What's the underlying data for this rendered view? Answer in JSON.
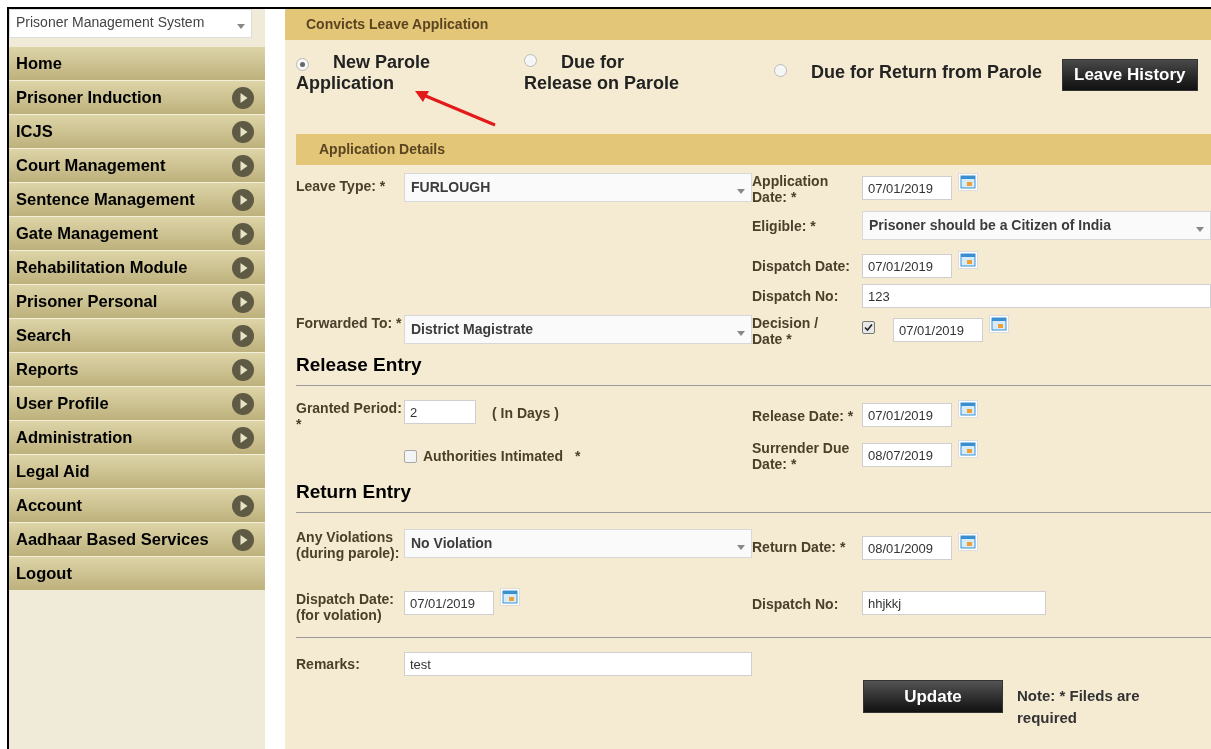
{
  "system_select": {
    "value": "Prisoner Management System"
  },
  "sidebar": {
    "items": [
      {
        "label": "Home",
        "has_submenu": false
      },
      {
        "label": "Prisoner Induction",
        "has_submenu": true
      },
      {
        "label": "ICJS",
        "has_submenu": true
      },
      {
        "label": "Court Management",
        "has_submenu": true
      },
      {
        "label": "Sentence Management",
        "has_submenu": true
      },
      {
        "label": "Gate Management",
        "has_submenu": true
      },
      {
        "label": "Rehabilitation Module",
        "has_submenu": true
      },
      {
        "label": "Prisoner Personal",
        "has_submenu": true
      },
      {
        "label": "Search",
        "has_submenu": true
      },
      {
        "label": "Reports",
        "has_submenu": true
      },
      {
        "label": "User Profile",
        "has_submenu": true
      },
      {
        "label": "Administration",
        "has_submenu": true
      },
      {
        "label": "Legal Aid",
        "has_submenu": false
      },
      {
        "label": "Account",
        "has_submenu": true
      },
      {
        "label": "Aadhaar Based Services",
        "has_submenu": true
      },
      {
        "label": "Logout",
        "has_submenu": false
      }
    ]
  },
  "header": {
    "title": "Convicts Leave Application"
  },
  "radios": [
    {
      "label": "New Parole Application",
      "selected": true
    },
    {
      "label": "Due for Release on Parole",
      "selected": false
    },
    {
      "label": "Due for Return from Parole",
      "selected": false
    }
  ],
  "leave_history_button": "Leave History",
  "application_details": {
    "title": "Application Details",
    "leave_type": {
      "label": "Leave Type: *",
      "value": "FURLOUGH"
    },
    "application_date": {
      "label": "Application Date: *",
      "value": "07/01/2019"
    },
    "eligible": {
      "label": "Eligible: *",
      "value": "Prisoner should be a Citizen of India"
    },
    "dispatch_date": {
      "label": "Dispatch Date:",
      "value": "07/01/2019"
    },
    "dispatch_no": {
      "label": "Dispatch No:",
      "value": "123"
    },
    "forwarded_to": {
      "label": "Forwarded To: *",
      "value": "District Magistrate"
    },
    "decision": {
      "label": "Decision / Date *",
      "checked": true,
      "value": "07/01/2019"
    }
  },
  "release_entry": {
    "title": "Release Entry",
    "granted_period": {
      "label": "Granted Period: *",
      "value": "2",
      "unit": "( In Days )"
    },
    "authorities_intimated": {
      "label": "Authorities Intimated",
      "checked": false,
      "required": "*"
    },
    "release_date": {
      "label": "Release Date: *",
      "value": "07/01/2019"
    },
    "surrender_due_date": {
      "label": "Surrender Due Date: *",
      "value": "08/07/2019"
    }
  },
  "return_entry": {
    "title": "Return Entry",
    "violations": {
      "label": "Any Violations (during parole):",
      "value": "No Violation"
    },
    "return_date": {
      "label": "Return Date: *",
      "value": "08/01/2009"
    },
    "dispatch_date": {
      "label": "Dispatch Date: (for volation)",
      "value": "07/01/2019"
    },
    "dispatch_no": {
      "label": "Dispatch No:",
      "value": "hhjkkj"
    }
  },
  "remarks": {
    "label": "Remarks:",
    "value": "test"
  },
  "update_button": "Update",
  "note": "Note: * Fileds are required"
}
